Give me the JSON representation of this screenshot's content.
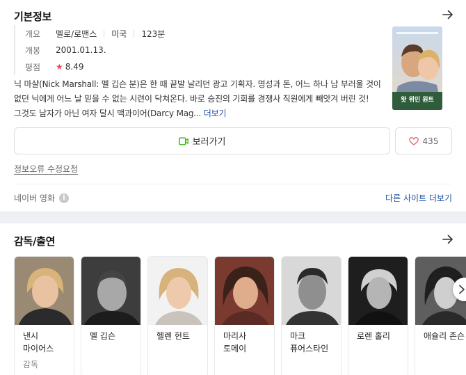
{
  "basic_info": {
    "title": "기본정보",
    "overview_label": "개요",
    "genre": "멜로/로맨스",
    "country": "미국",
    "runtime": "123분",
    "release_label": "개봉",
    "release_date": "2001.01.13.",
    "rating_label": "평점",
    "rating": "8.49",
    "description": "닉 마샬(Nick Marshall: 멜 깁슨 분)은 한 때 끝발 날리던 광고 기획자. 명성과 돈, 어느 하나 남 부러울 것이 없던 닉에게 어느 날 믿을 수 없는 시련이 닥쳐온다. 바로 승진의 기회를 경쟁사 직원에게 빼앗겨 버린 것! 그것도 남자가 아닌 여자 달시 맥과이어(Darcy Mag...",
    "more": "더보기",
    "watch": "보러가기",
    "likes": "435",
    "report": "정보오류 수정요청",
    "source": "네이버 영화",
    "other_sites": "다른 사이트 더보기"
  },
  "poster": {
    "title_text": "왓 위민 원트"
  },
  "cast": {
    "title": "감독/출연",
    "people": [
      {
        "name": "낸시 마이어스",
        "role": "감독"
      },
      {
        "name": "멜 깁슨",
        "role": ""
      },
      {
        "name": "헬렌 헌트",
        "role": ""
      },
      {
        "name": "마리사 토메이",
        "role": ""
      },
      {
        "name": "마크 퓨어스타인",
        "role": ""
      },
      {
        "name": "로렌 홀리",
        "role": ""
      },
      {
        "name": "애슐리 존슨",
        "role": ""
      }
    ]
  },
  "colors": {
    "accent_link": "#1f4fa8",
    "star": "#ec4a58",
    "watch_icon": "#2db400"
  }
}
